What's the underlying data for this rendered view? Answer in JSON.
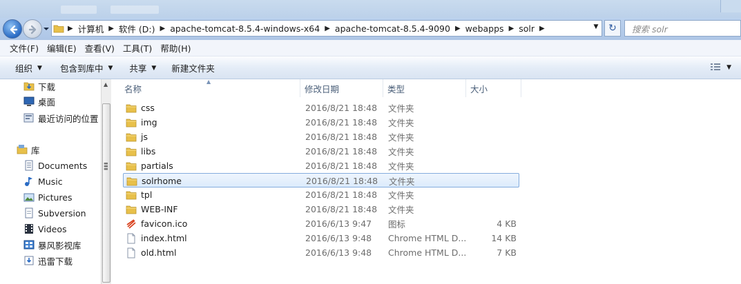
{
  "window": {
    "background_tabs": [
      "",
      ""
    ]
  },
  "address": {
    "crumbs": [
      "计算机",
      "软件 (D:)",
      "apache-tomcat-8.5.4-windows-x64",
      "apache-tomcat-8.5.4-9090",
      "webapps",
      "solr"
    ],
    "search_placeholder": "搜索 solr"
  },
  "menu": {
    "items": [
      "文件(F)",
      "编辑(E)",
      "查看(V)",
      "工具(T)",
      "帮助(H)"
    ]
  },
  "toolbar": {
    "organize": "组织",
    "include_in_library": "包含到库中",
    "share": "共享",
    "new_folder": "新建文件夹"
  },
  "nav": {
    "items": [
      {
        "label": "下载",
        "icon": "download-folder-icon"
      },
      {
        "label": "桌面",
        "icon": "desktop-icon"
      },
      {
        "label": "最近访问的位置",
        "icon": "recent-places-icon"
      },
      {
        "label": "库",
        "icon": "library-icon"
      },
      {
        "label": "Documents",
        "icon": "documents-icon"
      },
      {
        "label": "Music",
        "icon": "music-icon"
      },
      {
        "label": "Pictures",
        "icon": "pictures-icon"
      },
      {
        "label": "Subversion",
        "icon": "subversion-icon"
      },
      {
        "label": "Videos",
        "icon": "videos-icon"
      },
      {
        "label": "暴风影视库",
        "icon": "baofeng-library-icon"
      },
      {
        "label": "迅雷下载",
        "icon": "xunlei-download-icon"
      }
    ]
  },
  "columns": {
    "name": "名称",
    "modified": "修改日期",
    "type": "类型",
    "size": "大小"
  },
  "files": [
    {
      "name": "css",
      "date": "2016/8/21 18:48",
      "type": "文件夹",
      "size": "",
      "icon": "folder-icon"
    },
    {
      "name": "img",
      "date": "2016/8/21 18:48",
      "type": "文件夹",
      "size": "",
      "icon": "folder-icon"
    },
    {
      "name": "js",
      "date": "2016/8/21 18:48",
      "type": "文件夹",
      "size": "",
      "icon": "folder-icon"
    },
    {
      "name": "libs",
      "date": "2016/8/21 18:48",
      "type": "文件夹",
      "size": "",
      "icon": "folder-icon"
    },
    {
      "name": "partials",
      "date": "2016/8/21 18:48",
      "type": "文件夹",
      "size": "",
      "icon": "folder-icon"
    },
    {
      "name": "solrhome",
      "date": "2016/8/21 18:48",
      "type": "文件夹",
      "size": "",
      "icon": "folder-icon",
      "selected": true
    },
    {
      "name": "tpl",
      "date": "2016/8/21 18:48",
      "type": "文件夹",
      "size": "",
      "icon": "folder-icon"
    },
    {
      "name": "WEB-INF",
      "date": "2016/8/21 18:48",
      "type": "文件夹",
      "size": "",
      "icon": "folder-icon"
    },
    {
      "name": "favicon.ico",
      "date": "2016/6/13 9:47",
      "type": "图标",
      "size": "4 KB",
      "icon": "solr-favicon-icon"
    },
    {
      "name": "index.html",
      "date": "2016/6/13 9:48",
      "type": "Chrome HTML D...",
      "size": "14 KB",
      "icon": "html-file-icon"
    },
    {
      "name": "old.html",
      "date": "2016/6/13 9:48",
      "type": "Chrome HTML D...",
      "size": "7 KB",
      "icon": "html-file-icon"
    }
  ],
  "colors": {
    "selection_border": "#84acdd",
    "selection_fill": "#dcebfc",
    "folder": "#e8c04a"
  }
}
